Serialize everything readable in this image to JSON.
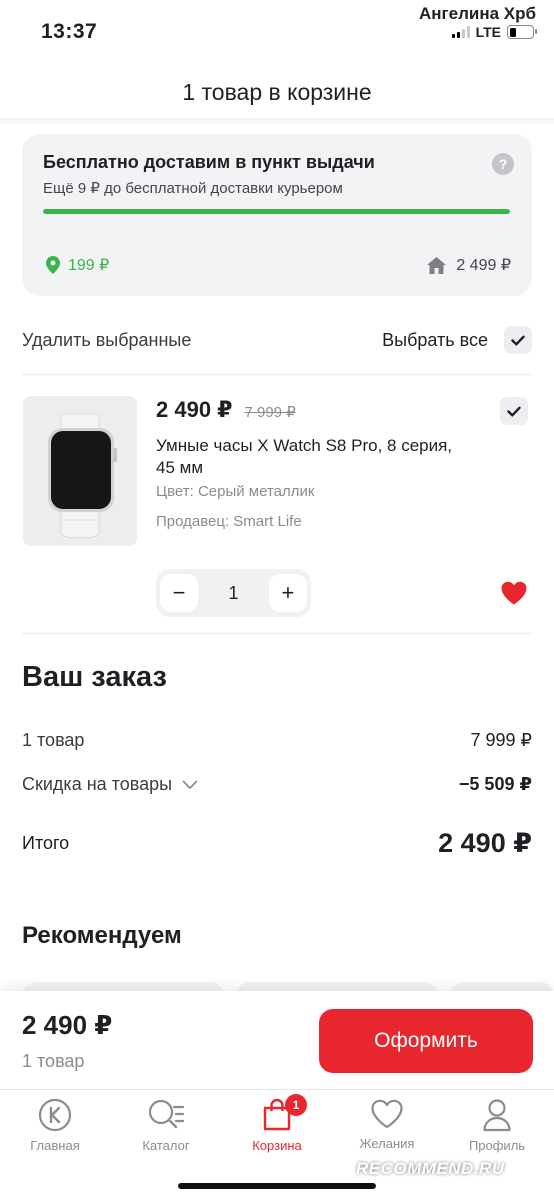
{
  "status": {
    "time": "13:37",
    "owner": "Ангелина Хрб",
    "network": "LTE"
  },
  "header": {
    "title": "1 товар в корзине"
  },
  "delivery": {
    "title": "Бесплатно доставим в пункт выдачи",
    "subtitle": "Ещё 9 ₽ до бесплатной доставки курьером",
    "help_icon": "?",
    "progress_fraction": 0.999,
    "pickup_price": "199 ₽",
    "courier_price": "2 499 ₽",
    "accent_green": "#3bb54a"
  },
  "selection": {
    "delete_label": "Удалить выбранные",
    "select_all_label": "Выбрать все"
  },
  "product": {
    "price": "2 490 ₽",
    "old_price": "7 999 ₽",
    "name": "Умные часы X Watch S8 Pro, 8 серия, 45 мм",
    "color": "Цвет: Серый металлик",
    "seller": "Продавец: Smart Life",
    "minus": "−",
    "quantity": "1",
    "plus": "+"
  },
  "order": {
    "title": "Ваш заказ",
    "items_label": "1 товар",
    "items_value": "7 999 ₽",
    "discount_label": "Скидка на товары",
    "discount_value": "−5 509 ₽",
    "total_label": "Итого",
    "total_value": "2 490 ₽"
  },
  "recommend": {
    "title": "Рекомендуем"
  },
  "checkout": {
    "price": "2 490 ₽",
    "count": "1 товар",
    "button_label": "Оформить",
    "accent_red": "#e8262d"
  },
  "tabbar": {
    "items": [
      {
        "label": "Главная",
        "icon": "home-k-icon"
      },
      {
        "label": "Каталог",
        "icon": "catalog-search-icon"
      },
      {
        "label": "Корзина",
        "icon": "bag-icon",
        "badge": "1"
      },
      {
        "label": "Желания",
        "icon": "heart-icon"
      },
      {
        "label": "Профиль",
        "icon": "profile-icon"
      }
    ]
  },
  "watermark": "RECOMMEND.RU"
}
